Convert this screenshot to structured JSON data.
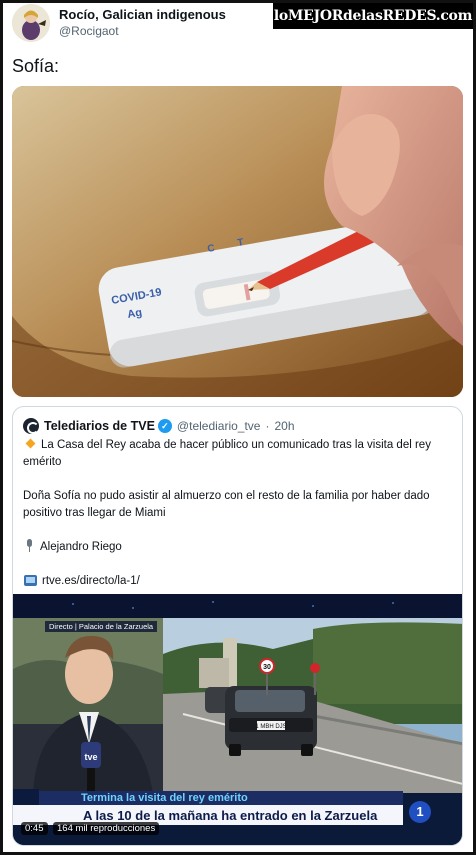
{
  "tweet": {
    "author_name": "Rocío, Galician indigenous",
    "author_handle": "@Rocigaot",
    "text": "Sofía:",
    "photo": {
      "test_label_line1": "COVID-19",
      "test_label_line2": "Ag",
      "test_mark_c": "C",
      "test_mark_t": "T"
    }
  },
  "watermark": "loMEJORdelasREDES.com",
  "quote": {
    "name": "Telediarios de TVE",
    "handle": "@telediario_tve",
    "separator": "·",
    "time": "20h",
    "line1": "La Casa del Rey acaba de hacer público un comunicado tras la visita del rey emérito",
    "line2": "Doña Sofía no pudo asistir al almuerzo con el resto de la familia por haber dado positivo tras llegar de Miami",
    "reporter": "Alejandro Riego",
    "link": "rtve.es/directo/la-1/",
    "video": {
      "location": "Directo | Palacio de la Zarzuela",
      "mic_label": "tve",
      "headline": "Termina la visita del rey emérito",
      "subline": "A las 10 de la mañana ha entrado en la Zarzuela",
      "channel": "1",
      "duration": "0:45",
      "views": "164 mil reproducciones",
      "speed_sign": "30",
      "plate": "1 MBH DJS"
    }
  }
}
